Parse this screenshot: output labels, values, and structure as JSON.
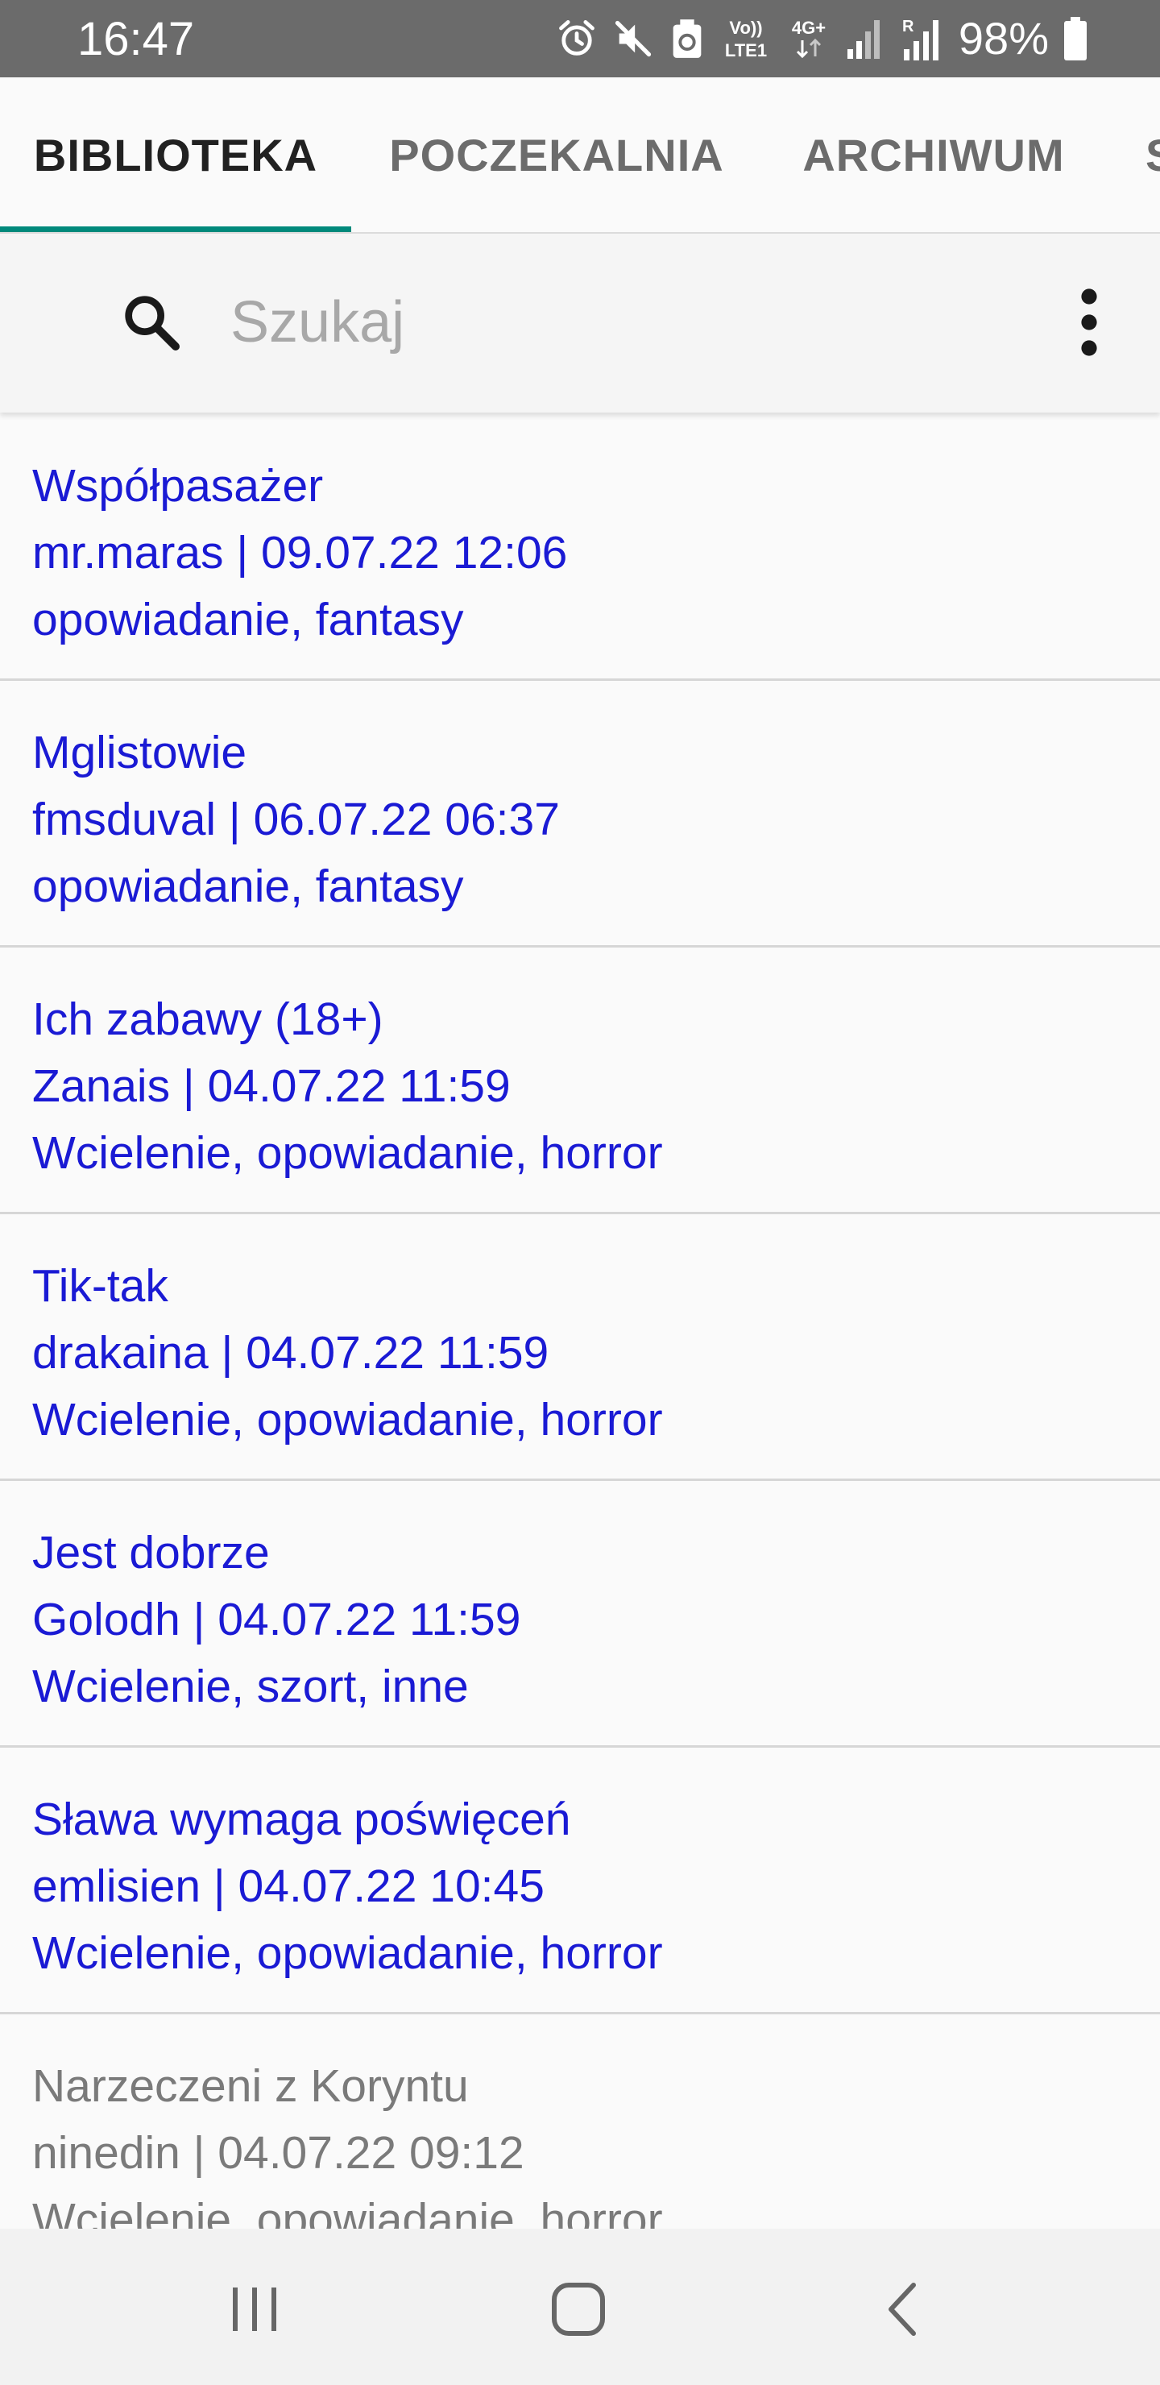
{
  "status_bar": {
    "time": "16:47",
    "icons": [
      "alarm-icon",
      "mute-icon",
      "data-saver-icon",
      "volte-lte-icon",
      "4g-data-icon",
      "signal-icon",
      "roaming-signal-icon"
    ],
    "battery_text": "98%",
    "volte_label_top": "Vo))",
    "volte_label_bottom": "LTE1",
    "network_label": "4G+",
    "roaming_label": "R"
  },
  "tabs": [
    {
      "label": "BIBLIOTEKA",
      "active": true
    },
    {
      "label": "POCZEKALNIA",
      "active": false
    },
    {
      "label": "ARCHIWUM",
      "active": false
    },
    {
      "label": "S",
      "active": false
    }
  ],
  "search": {
    "placeholder": "Szukaj",
    "value": ""
  },
  "stories": [
    {
      "title": "Współpasażer",
      "meta": "mr.maras | 09.07.22 12:06",
      "tags": "opowiadanie, fantasy",
      "read": false
    },
    {
      "title": "Mglistowie",
      "meta": "fmsduval | 06.07.22 06:37",
      "tags": "opowiadanie, fantasy",
      "read": false
    },
    {
      "title": "Ich zabawy (18+)",
      "meta": "Zanais | 04.07.22 11:59",
      "tags": "Wcielenie, opowiadanie, horror",
      "read": false
    },
    {
      "title": "Tik-tak",
      "meta": "drakaina | 04.07.22 11:59",
      "tags": "Wcielenie, opowiadanie, horror",
      "read": false
    },
    {
      "title": "Jest dobrze",
      "meta": "Golodh | 04.07.22 11:59",
      "tags": "Wcielenie, szort, inne",
      "read": false
    },
    {
      "title": "Sława wymaga poświęceń",
      "meta": "emlisien | 04.07.22 10:45",
      "tags": "Wcielenie, opowiadanie, horror",
      "read": false
    },
    {
      "title": "Narzeczeni z Koryntu",
      "meta": "ninedin | 04.07.22 09:12",
      "tags": "Wcielenie, opowiadanie, horror",
      "read": true
    }
  ],
  "nav_bar": {
    "icons": [
      "recent-apps-icon",
      "home-icon",
      "back-icon"
    ]
  },
  "colors": {
    "status_bar": "#6b6b6b",
    "tab_indicator": "#00897b",
    "unread_text": "#1a1ad4",
    "read_text": "#7a7a7a"
  }
}
